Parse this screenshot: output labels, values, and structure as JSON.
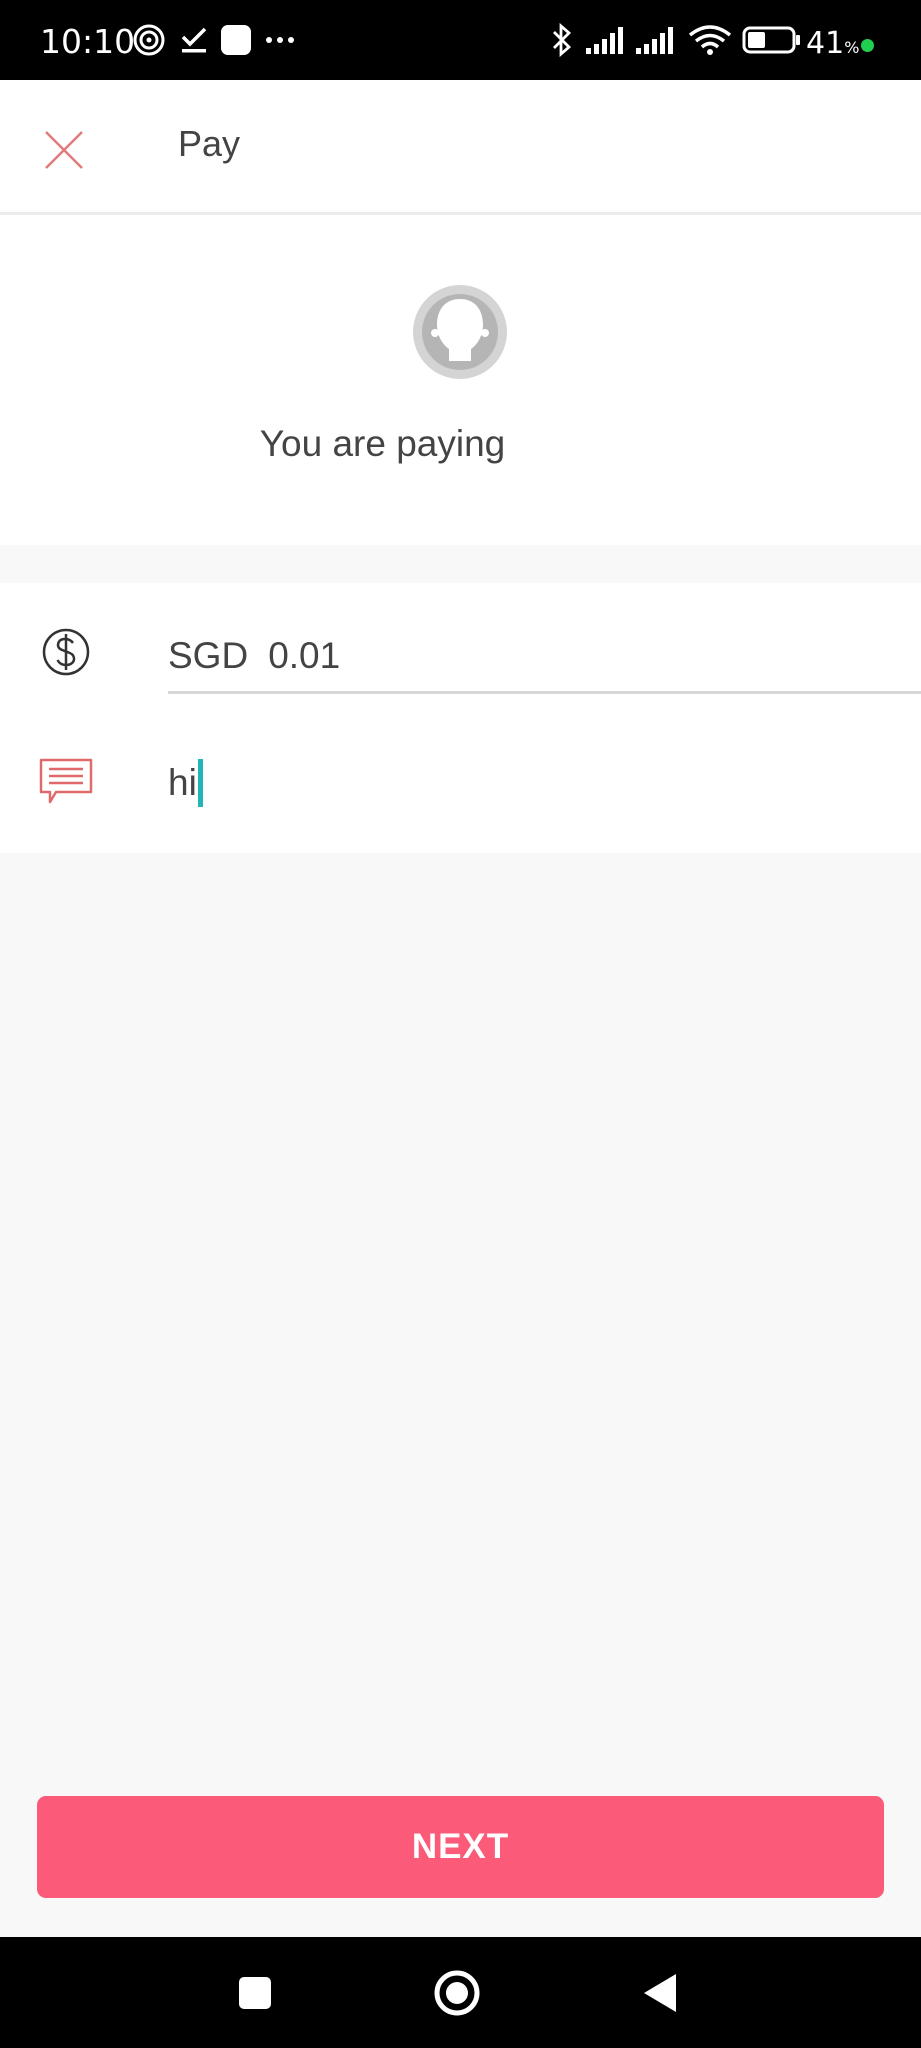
{
  "status_bar": {
    "time": "10:10",
    "battery_percent": "41",
    "battery_unit": "%",
    "battery_level": 0.41,
    "icons": [
      "hotspot-icon",
      "download-done-icon",
      "app-icon",
      "more-icon",
      "bluetooth-icon",
      "signal-icon",
      "signal-icon",
      "wifi-icon",
      "battery-icon"
    ]
  },
  "header": {
    "title": "Pay",
    "close_icon": "close-icon"
  },
  "payee": {
    "avatar_icon": "avatar-placeholder-icon",
    "label": "You are paying"
  },
  "form": {
    "amount": {
      "icon": "dollar-circle-icon",
      "currency": "SGD",
      "value": "0.01"
    },
    "message": {
      "icon": "message-icon",
      "value": "hi"
    }
  },
  "actions": {
    "next_label": "NEXT"
  },
  "nav_bar": {
    "icons": [
      "recents-icon",
      "home-icon",
      "back-icon"
    ]
  },
  "colors": {
    "accent": "#fb5a78",
    "caret": "#23b5b5",
    "icon_red": "#e06a6a"
  }
}
